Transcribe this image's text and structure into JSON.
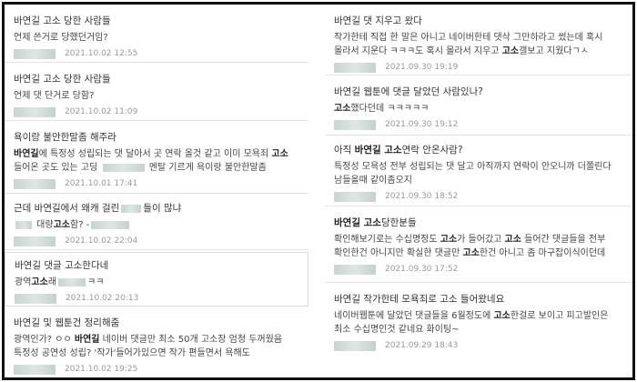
{
  "left": [
    {
      "title": "바연길 고소 당한 사람들",
      "body_html": "언제 쓴거로 당했던거임?",
      "date": "2021.10.02 12:55"
    },
    {
      "title": "바연길 고소 당한 사람들",
      "body_html": "언제 댓 단거로 당함?",
      "date": "2021.10.02 11:09"
    },
    {
      "title": "욕이랑 불안한말좀 해주라",
      "body_html": "<b>바연길</b>에 특정성 성립되는 댓 달아서 곳 연락 올것 같고 이미 모욕죄 <b>고소</b> 들어온 곳도 있는 고딩 <span class=\"blur\" style=\"width:46px\"></span> 멘탈 기르게 욕이랑 불안한말좀",
      "date": "2021.10.01 17:41"
    },
    {
      "title": "근데 바연길에서 왜캐 걸린<span class=\"blur\" style=\"width:22px\"></span>들이 많냐",
      "body_html": "<span class=\"blur\" style=\"width:18px\"></span> 대량<b>고소</b>함? -<span class=\"blur\" style=\"width:42px\"></span>",
      "date": "2021.10.02 22:04"
    },
    {
      "title": "바연길 댓글 고소한다네",
      "body_html": "광역<b>고소</b>래<span class=\"blur\" style=\"width:30px\"></span>ㅋㅋ",
      "date": "2021.10.02 20:13"
    },
    {
      "title": "바연길 및 웹툰건 정리해줌",
      "body_html": "광역인가? ㅇㅇ <b>바연길</b> 네이버 댓글만 최소 50개 고소장 엄청 두꺼웠음 특정성 공연성 성립? '작가'들어가있으면 작가 편들면서 욕해도 <b>고소</b>들어간거같음 코",
      "date": "2021.10.02 19:25"
    }
  ],
  "right": [
    {
      "title": "바연길 댓 지우고 왔다",
      "body_html": "작가한테 직접 한 말은 아니고 네이버한테 댓삭 그만하라고 썼는데 혹시 몰라서 지운다 ㅋㅋㅋ도 혹시 몰라서 지우고 <b>고소</b>갤보고 지웠다ㄱㅅ",
      "date": "2021.09.30 19:19"
    },
    {
      "title": "바연길 웹툰에 댓글 달았던 사람있나?",
      "body_html": "<b>고소</b>했다던데 ㅋㅋㅋㅋㅋ",
      "date": "2021.09.30 19:12"
    },
    {
      "title": "아직 <b>바연길 고소</b>연락 안온사람?",
      "body_html": "특정성 모욕성 전부 성립되는 댓 달고 아직까지 연락이 안오니까 더쫄린다 남들올때 같이좀오지",
      "date": "2021.09.30 18:52"
    },
    {
      "title": "<b>바연길 고소</b>당한분들",
      "body_html": "확인해보기로는 수십명정도 <b>고소</b>가 들어갔고 <b>고소</b> 들어간 댓글들을 전부 확인한건 아니지만 확실한 댓글만 <b>고소</b>한건 아니고 좀 마구잡이식이던데 본인이",
      "date": "2021.09.30 17:52"
    },
    {
      "title": "바연길 작가한테 모욕죄로 고소 들어왔네요",
      "body_html": "네이버웹툰에 달았던 댓글들을 6월정도에 <b>고소</b>한걸로 보이고 피고발인은 최소 수십명인것 같네요 화이팅~",
      "date": "2021.09.29 18:43"
    }
  ]
}
